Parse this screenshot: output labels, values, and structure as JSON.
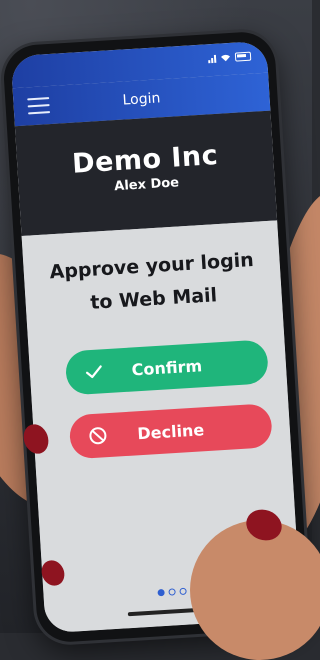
{
  "app": {
    "title": "Login",
    "company": "Demo Inc",
    "user": "Alex Doe"
  },
  "prompt": {
    "line1": "Approve your login",
    "line2": "to Web Mail"
  },
  "actions": {
    "confirm_label": "Confirm",
    "decline_label": "Decline"
  },
  "pager": {
    "total": 3,
    "active": 1
  },
  "icons": {
    "menu": "hamburger-menu-icon",
    "confirm": "checkmark-icon",
    "decline": "prohibited-icon"
  },
  "colors": {
    "appbar": "#2e63d6",
    "header": "#23252b",
    "confirm": "#1fb57b",
    "decline": "#e7495a"
  }
}
